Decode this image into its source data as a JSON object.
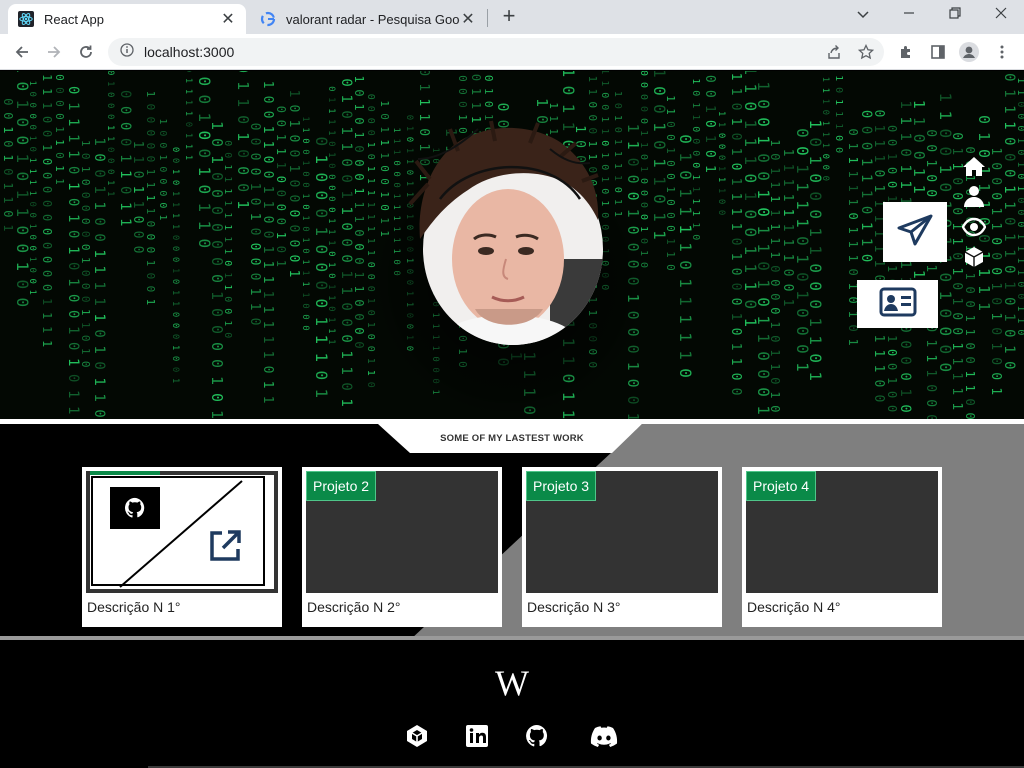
{
  "browser": {
    "tabs": [
      {
        "title": "React App",
        "active": true,
        "icon": "react-icon"
      },
      {
        "title": "valorant radar - Pesquisa Google",
        "active": false,
        "icon": "google-icon"
      }
    ],
    "address": "localhost:3000"
  },
  "portfolio": {
    "nav_icons": [
      "home-icon",
      "user-icon",
      "eye-icon",
      "cube-icon"
    ],
    "work_title": "SOME OF MY LASTEST WORK",
    "projects": [
      {
        "tag": "",
        "description": "Descrição N 1°"
      },
      {
        "tag": "Projeto 2",
        "description": "Descrição N 2°"
      },
      {
        "tag": "Projeto 3",
        "description": "Descrição N 3°"
      },
      {
        "tag": "Projeto 4",
        "description": "Descrição N 4°"
      }
    ],
    "footer_logo": "W",
    "social_icons": [
      "unity-icon",
      "linkedin-icon",
      "github-icon",
      "discord-icon"
    ]
  },
  "colors": {
    "accent_green": "#0a8a48",
    "matrix_green": "#22c55e",
    "hero_bg": "#030803",
    "icon_navy": "#1e3a5f"
  }
}
